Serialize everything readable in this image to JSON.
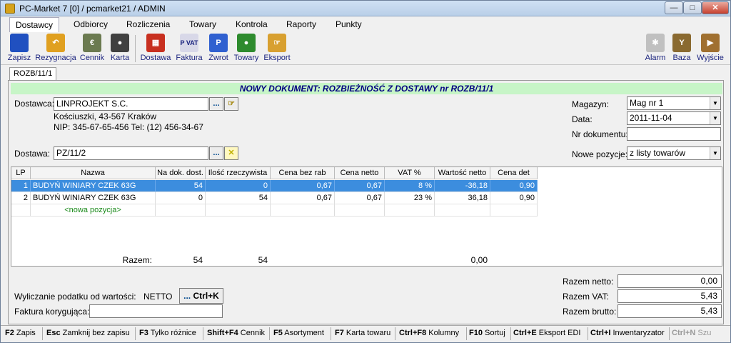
{
  "window": {
    "title": "PC-Market 7 [0] / pcmarket21 / ADMIN"
  },
  "menu": [
    "Dostawcy",
    "Odbiorcy",
    "Rozliczenia",
    "Towary",
    "Kontrola",
    "Raporty",
    "Punkty"
  ],
  "toolbar": {
    "left": [
      "Zapisz",
      "Rezygnacja",
      "Cennik",
      "Karta",
      "Dostawa",
      "Faktura",
      "Zwrot",
      "Towary",
      "Eksport"
    ],
    "right": [
      "Alarm",
      "Baza",
      "Wyjście"
    ],
    "icons": {
      "faktura": "P VAT",
      "zwrot": "P"
    }
  },
  "tab": "ROZB/11/1",
  "doc_title": "NOWY DOKUMENT: ROZBIEŻNOŚĆ Z DOSTAWY nr ROZB/11/1",
  "supplier": {
    "label": "Dostawca:",
    "name": "LINPROJEKT S.C.",
    "address": "Kościuszki, 43-567 Kraków",
    "nip": "NIP: 345-67-65-456 Tel: (12) 456-34-67",
    "more": "..."
  },
  "delivery": {
    "label": "Dostawa:",
    "value": "PZ/11/2",
    "more": "..."
  },
  "magazyn": {
    "label": "Magazyn:",
    "value": "Mag nr 1"
  },
  "data": {
    "label": "Data:",
    "value": "2011-11-04"
  },
  "nr_dokumentu": {
    "label": "Nr dokumentu:",
    "value": ""
  },
  "nowe_pozycje": {
    "label": "Nowe pozycje:",
    "value": "z listy towarów"
  },
  "columns": [
    "LP",
    "Nazwa",
    "Na dok. dost.",
    "Ilość rzeczywista",
    "Cena bez rab",
    "Cena netto",
    "VAT %",
    "Wartość netto",
    "Cena det"
  ],
  "rows": [
    {
      "lp": "1",
      "nazwa": "BUDYŃ WINIARY CZEK 63G",
      "na_dok": "54",
      "ilosc": "0",
      "cena_bez": "0,67",
      "cena_netto": "0,67",
      "vat": "8 %",
      "wartosc": "-36,18",
      "cena_det": "0,90"
    },
    {
      "lp": "2",
      "nazwa": "BUDYŃ WINIARY CZEK 63G",
      "na_dok": "0",
      "ilosc": "54",
      "cena_bez": "0,67",
      "cena_netto": "0,67",
      "vat": "23 %",
      "wartosc": "36,18",
      "cena_det": "0,90"
    }
  ],
  "new_row": "<nowa pozycja>",
  "totals": {
    "label": "Razem:",
    "na_dok": "54",
    "ilosc": "54",
    "wartosc": "0,00"
  },
  "tax": {
    "label": "Wyliczanie podatku od wartości:",
    "value": "NETTO",
    "button": "Ctrl+K",
    "button_prefix": "..."
  },
  "invoice_corr": {
    "label": "Faktura korygująca:",
    "value": ""
  },
  "summary": {
    "netto_label": "Razem netto:",
    "netto": "0,00",
    "vat_label": "Razem VAT:",
    "vat": "5,43",
    "brutto_label": "Razem brutto:",
    "brutto": "5,43"
  },
  "shortcuts": [
    {
      "key": "F2",
      "label": "Zapis"
    },
    {
      "key": "Esc",
      "label": "Zamknij bez zapisu"
    },
    {
      "key": "F3",
      "label": "Tylko różnice"
    },
    {
      "key": "Shift+F4",
      "label": "Cennik"
    },
    {
      "key": "F5",
      "label": "Asortyment"
    },
    {
      "key": "F7",
      "label": "Karta towaru"
    },
    {
      "key": "Ctrl+F8",
      "label": "Kolumny"
    },
    {
      "key": "F10",
      "label": "Sortuj"
    },
    {
      "key": "Ctrl+E",
      "label": "Eksport EDI"
    },
    {
      "key": "Ctrl+I",
      "label": "Inwentaryzator"
    },
    {
      "key": "Ctrl+N",
      "label": "Szu"
    }
  ]
}
